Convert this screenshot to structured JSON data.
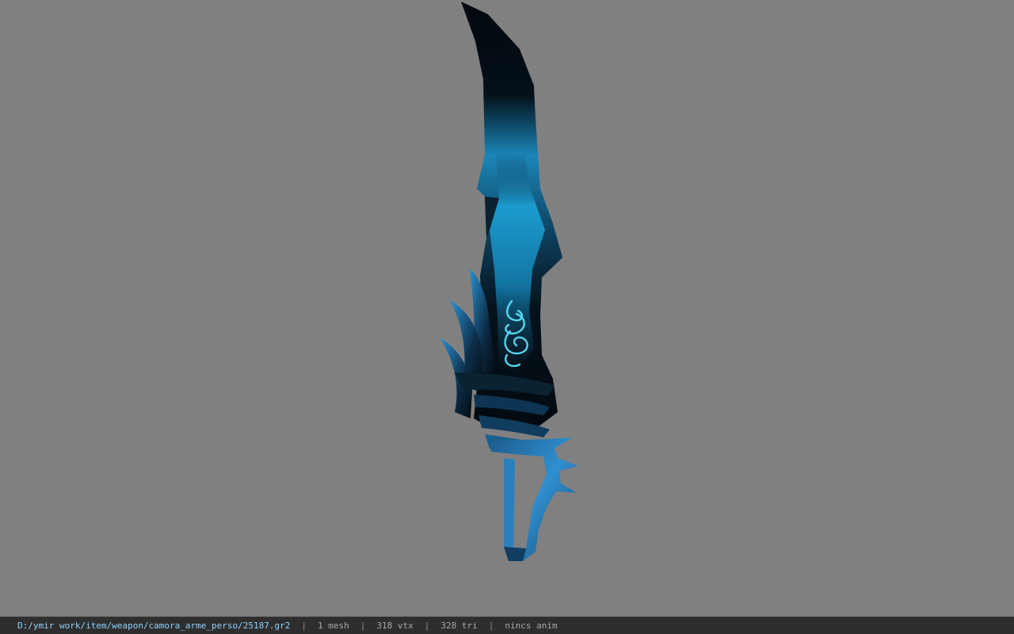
{
  "viewer": {
    "background_color": "#808080",
    "model": {
      "description": "curved dark blade with glowing cyan rune and spiked blue hilt",
      "colors": {
        "blade_dark": "#06121c",
        "blade_glow": "#1f97c9",
        "rune": "#5ee8ff",
        "hilt": "#2d86c7"
      }
    }
  },
  "statusbar": {
    "file_path": "D:/ymir work/item/weapon/camora_arme_perso/25187.gr2",
    "separator": "|",
    "mesh_count": "1 mesh",
    "vertex_count": "318 vtx",
    "triangle_count": "328 tri",
    "animation": "nincs anim"
  }
}
